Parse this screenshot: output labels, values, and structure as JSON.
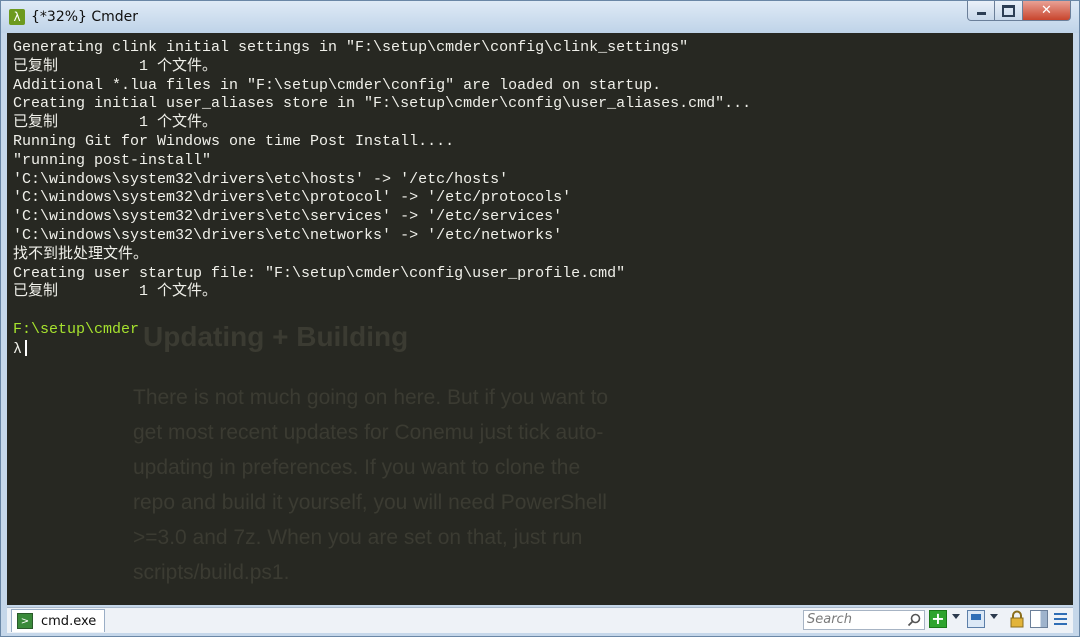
{
  "window": {
    "title": "{*32%} Cmder",
    "app_icon_glyph": "λ",
    "controls": [
      "minimize-icon",
      "maximize-icon",
      "close-icon"
    ],
    "close_glyph": "✕"
  },
  "console": {
    "lines": [
      "Generating clink initial settings in \"F:\\setup\\cmder\\config\\clink_settings\"",
      "已复制         1 个文件。",
      "Additional *.lua files in \"F:\\setup\\cmder\\config\" are loaded on startup.",
      "Creating initial user_aliases store in \"F:\\setup\\cmder\\config\\user_aliases.cmd\"...",
      "已复制         1 个文件。",
      "Running Git for Windows one time Post Install....",
      "\"running post-install\"",
      "'C:\\windows\\system32\\drivers\\etc\\hosts' -> '/etc/hosts'",
      "'C:\\windows\\system32\\drivers\\etc\\protocol' -> '/etc/protocols'",
      "'C:\\windows\\system32\\drivers\\etc\\services' -> '/etc/services'",
      "'C:\\windows\\system32\\drivers\\etc\\networks' -> '/etc/networks'",
      "找不到批处理文件。",
      "Creating user startup file: \"F:\\setup\\cmder\\config\\user_profile.cmd\"",
      "已复制         1 个文件。",
      ""
    ],
    "prompt_path": "F:\\setup\\cmder",
    "prompt_symbol": "λ",
    "colors": {
      "background": "#272822",
      "text": "#f0f0ea",
      "prompt_path": "#a6e22e"
    }
  },
  "background_doc": {
    "heading": "Updating + Building",
    "para_lines": [
      "There is not much going on here. But if you want to",
      "get most recent updates for Conemu just tick auto-",
      "updating in preferences. If you want to clone the",
      "repo and build it yourself, you will need PowerShell",
      ">=3.0 and 7z. When you are set on that, just run",
      "scripts/build.ps1."
    ]
  },
  "statusbar": {
    "tab_label": "cmd.exe",
    "search_placeholder": "Search",
    "icons": [
      "cmd-tab-icon",
      "search-icon",
      "new-console-icon",
      "console-list-icon",
      "lock-icon",
      "scrollbar-toggle-icon",
      "menu-icon"
    ]
  }
}
